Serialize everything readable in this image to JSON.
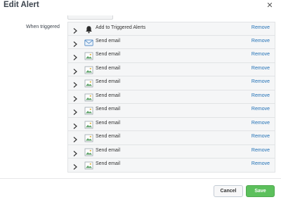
{
  "dialog": {
    "title": "Edit Alert",
    "close_glyph": "✕"
  },
  "trigger": {
    "label": "When triggered",
    "actions": [
      {
        "label": "Add to Triggered Alerts",
        "icon": "bell-icon",
        "remove": "Remove"
      },
      {
        "label": "Send email",
        "icon": "envelope-icon",
        "remove": "Remove"
      },
      {
        "label": "Send email",
        "icon": "image-icon",
        "remove": "Remove"
      },
      {
        "label": "Send email",
        "icon": "image-icon",
        "remove": "Remove"
      },
      {
        "label": "Send email",
        "icon": "image-icon",
        "remove": "Remove"
      },
      {
        "label": "Send email",
        "icon": "image-icon",
        "remove": "Remove"
      },
      {
        "label": "Send email",
        "icon": "image-icon",
        "remove": "Remove"
      },
      {
        "label": "Send email",
        "icon": "image-icon",
        "remove": "Remove"
      },
      {
        "label": "Send email",
        "icon": "image-icon",
        "remove": "Remove"
      },
      {
        "label": "Send email",
        "icon": "image-icon",
        "remove": "Remove"
      },
      {
        "label": "Send email",
        "icon": "image-icon",
        "remove": "Remove"
      }
    ]
  },
  "footer": {
    "cancel_label": "Cancel",
    "save_label": "Save"
  },
  "colors": {
    "link": "#1f6fb5",
    "save": "#5cc05c",
    "row_bg": "#f5f6f7"
  }
}
